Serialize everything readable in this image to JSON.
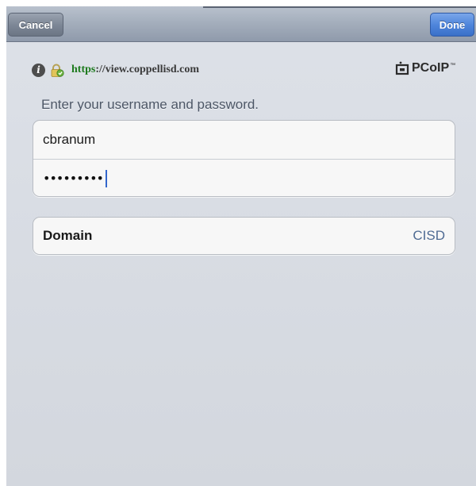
{
  "toolbar": {
    "cancel_label": "Cancel",
    "done_label": "Done"
  },
  "header": {
    "url_scheme": "https",
    "url_rest": "://view.coppellisd.com",
    "info_icon": "info-icon",
    "lock_icon": "lock-icon",
    "logo_text": "PCoIP",
    "logo_tm": "™"
  },
  "login": {
    "prompt": "Enter your username and password.",
    "username_value": "cbranum",
    "password_masked": "•••••••••"
  },
  "domain": {
    "label": "Domain",
    "value": "CISD"
  },
  "colors": {
    "done_accent": "#4f86dc",
    "url_scheme": "#1d7a1d",
    "domain_value": "#4f6b93"
  }
}
